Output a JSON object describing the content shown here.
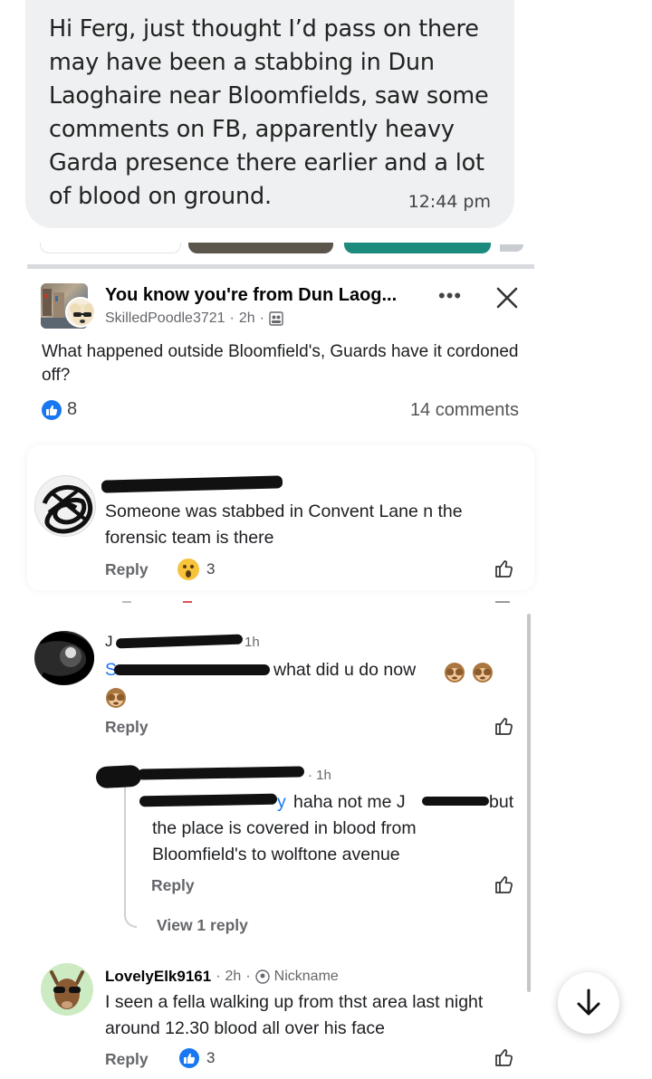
{
  "message": {
    "text": "Hi Ferg, just thought I’d pass on there may have been a stabbing in Dun Laoghaire near Bloomfields, saw some comments on FB, apparently heavy Garda presence there earlier and a lot of blood on ground.",
    "time": "12:44 pm"
  },
  "post": {
    "group_name": "You know you're from Dun Laog...",
    "author": "SkilledPoodle3721",
    "time": "2h",
    "body": "What happened outside Bloomfield's, Guards have it cordoned off?",
    "likes": "8",
    "comments_count": "14 comments"
  },
  "comments": [
    {
      "text": "Someone was stabbed in Convent Lane n the forensic team is there",
      "reply_label": "Reply",
      "reactions": "3"
    },
    {
      "name_visible": "J",
      "time": "1h",
      "mention_visible": "S",
      "text": "what did u do now",
      "reply_label": "Reply"
    },
    {
      "time": "1h",
      "mention_tail": "y",
      "text_a": "haha not me J",
      "text_b": "but",
      "text_c": "the place is covered in blood from Bloomfield's to wolftone avenue",
      "reply_label": "Reply",
      "view_replies": "View 1 reply"
    },
    {
      "author": "LovelyElk9161",
      "time": "2h",
      "badge": "Nickname",
      "text": "I seen a fella walking up from thst area last night around 12.30 blood all over his face",
      "reply_label": "Reply",
      "reactions": "3"
    }
  ],
  "colors": {
    "bubble": "#eef0f1",
    "like_blue": "#1877f2",
    "meta_gray": "#65676b"
  }
}
